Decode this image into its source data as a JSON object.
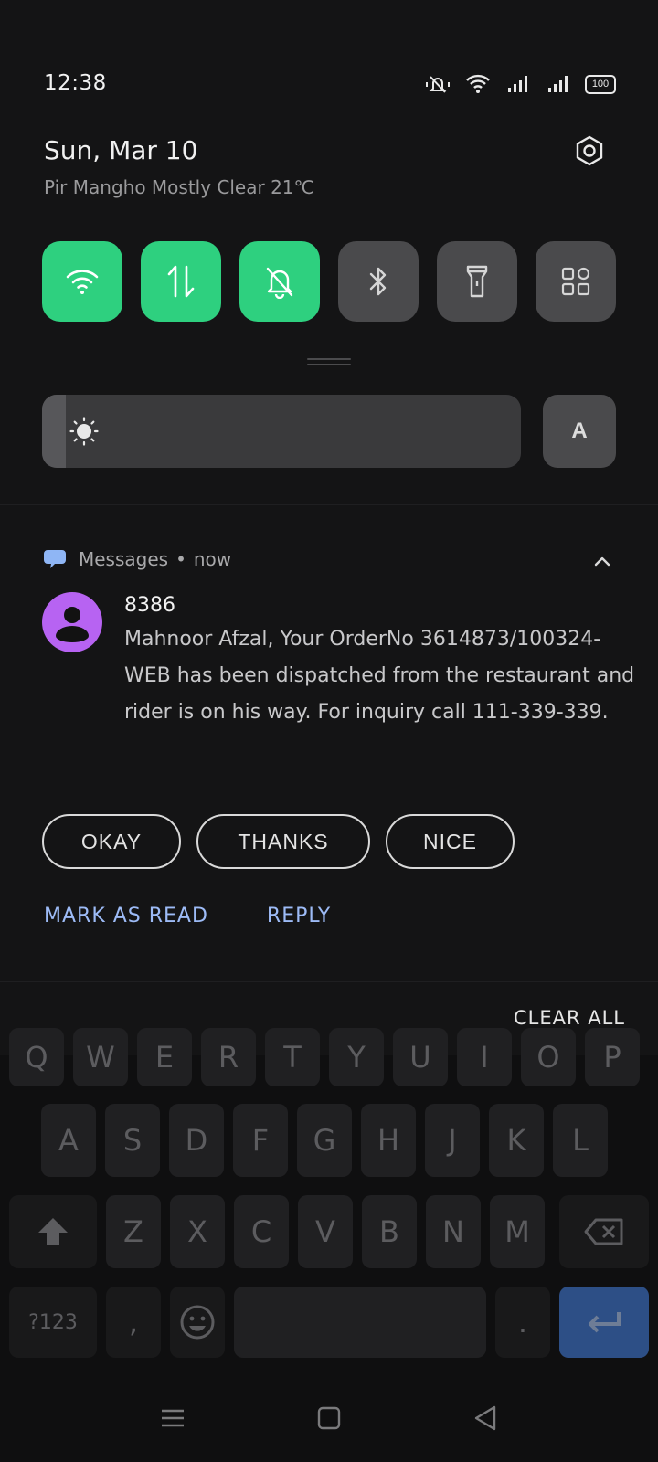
{
  "status_bar": {
    "time": "12:38",
    "battery": "100"
  },
  "header": {
    "date": "Sun, Mar 10",
    "weather": "Pir Mangho Mostly Clear 21℃"
  },
  "quick_tiles": [
    {
      "icon": "wifi-icon",
      "active": true
    },
    {
      "icon": "mobile-data-icon",
      "active": true
    },
    {
      "icon": "silent-mode-icon",
      "active": true
    },
    {
      "icon": "bluetooth-icon",
      "active": false
    },
    {
      "icon": "flashlight-icon",
      "active": false
    },
    {
      "icon": "edit-tiles-icon",
      "active": false
    }
  ],
  "brightness": {
    "level": 0.05,
    "auto_label": "A"
  },
  "notification": {
    "app": "Messages",
    "separator": "•",
    "time": "now",
    "sender": "8386",
    "message": "Mahnoor Afzal, Your OrderNo 3614873/100324-WEB has been dispatched from the restaurant and rider is on his way. For inquiry call 111-339-339.",
    "quick_replies": [
      "OKAY",
      "THANKS",
      "NICE"
    ],
    "actions": [
      "MARK AS READ",
      "REPLY"
    ]
  },
  "clear_all": "CLEAR ALL",
  "keyboard": {
    "row_top_partial": [
      "Q",
      "W",
      "E",
      "R",
      "T",
      "Y",
      "U",
      "I",
      "O",
      "P"
    ],
    "row2": [
      "A",
      "S",
      "D",
      "F",
      "G",
      "H",
      "J",
      "K",
      "L"
    ],
    "row3": [
      "Z",
      "X",
      "C",
      "V",
      "B",
      "N",
      "M"
    ],
    "symbols_key": "?123",
    "comma_key": ",",
    "period_key": "."
  },
  "colors": {
    "tile_active": "#2ed07f",
    "tile_inactive": "#4a4a4c",
    "action_text": "#9dbbf6",
    "avatar": "#b763f2",
    "enter_key": "#2d4f86"
  }
}
